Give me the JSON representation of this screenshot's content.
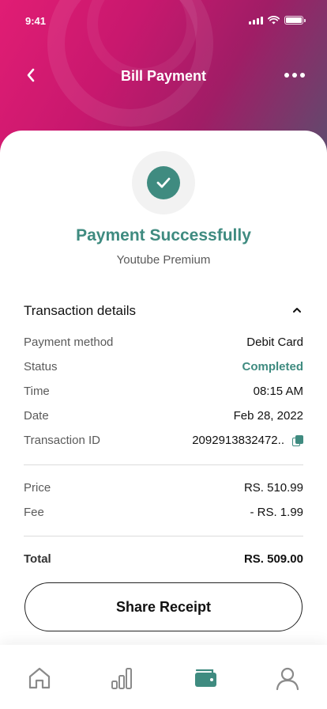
{
  "status_bar": {
    "time": "9:41"
  },
  "nav": {
    "title": "Bill Payment"
  },
  "success": {
    "title": "Payment Successfully",
    "subtitle": "Youtube Premium"
  },
  "transaction": {
    "section_title": "Transaction details",
    "details": [
      {
        "label": "Payment method",
        "value": "Debit Card"
      },
      {
        "label": "Status",
        "value": "Completed"
      },
      {
        "label": "Time",
        "value": "08:15 AM"
      },
      {
        "label": "Date",
        "value": "Feb 28, 2022"
      },
      {
        "label": "Transaction ID",
        "value": "2092913832472.."
      }
    ],
    "charges": [
      {
        "label": "Price",
        "value": "RS. 510.99"
      },
      {
        "label": "Fee",
        "value": "- RS. 1.99"
      }
    ],
    "total": {
      "label": "Total",
      "value": "RS. 509.00"
    }
  },
  "share_button": {
    "label": "Share Receipt"
  },
  "tabs": [
    {
      "icon": "home-icon"
    },
    {
      "icon": "chart-icon"
    },
    {
      "icon": "wallet-icon",
      "active": true
    },
    {
      "icon": "profile-icon"
    }
  ],
  "colors": {
    "accent": "#3f8b80",
    "header_start": "#e11d74",
    "header_end": "#5e4c6e"
  }
}
